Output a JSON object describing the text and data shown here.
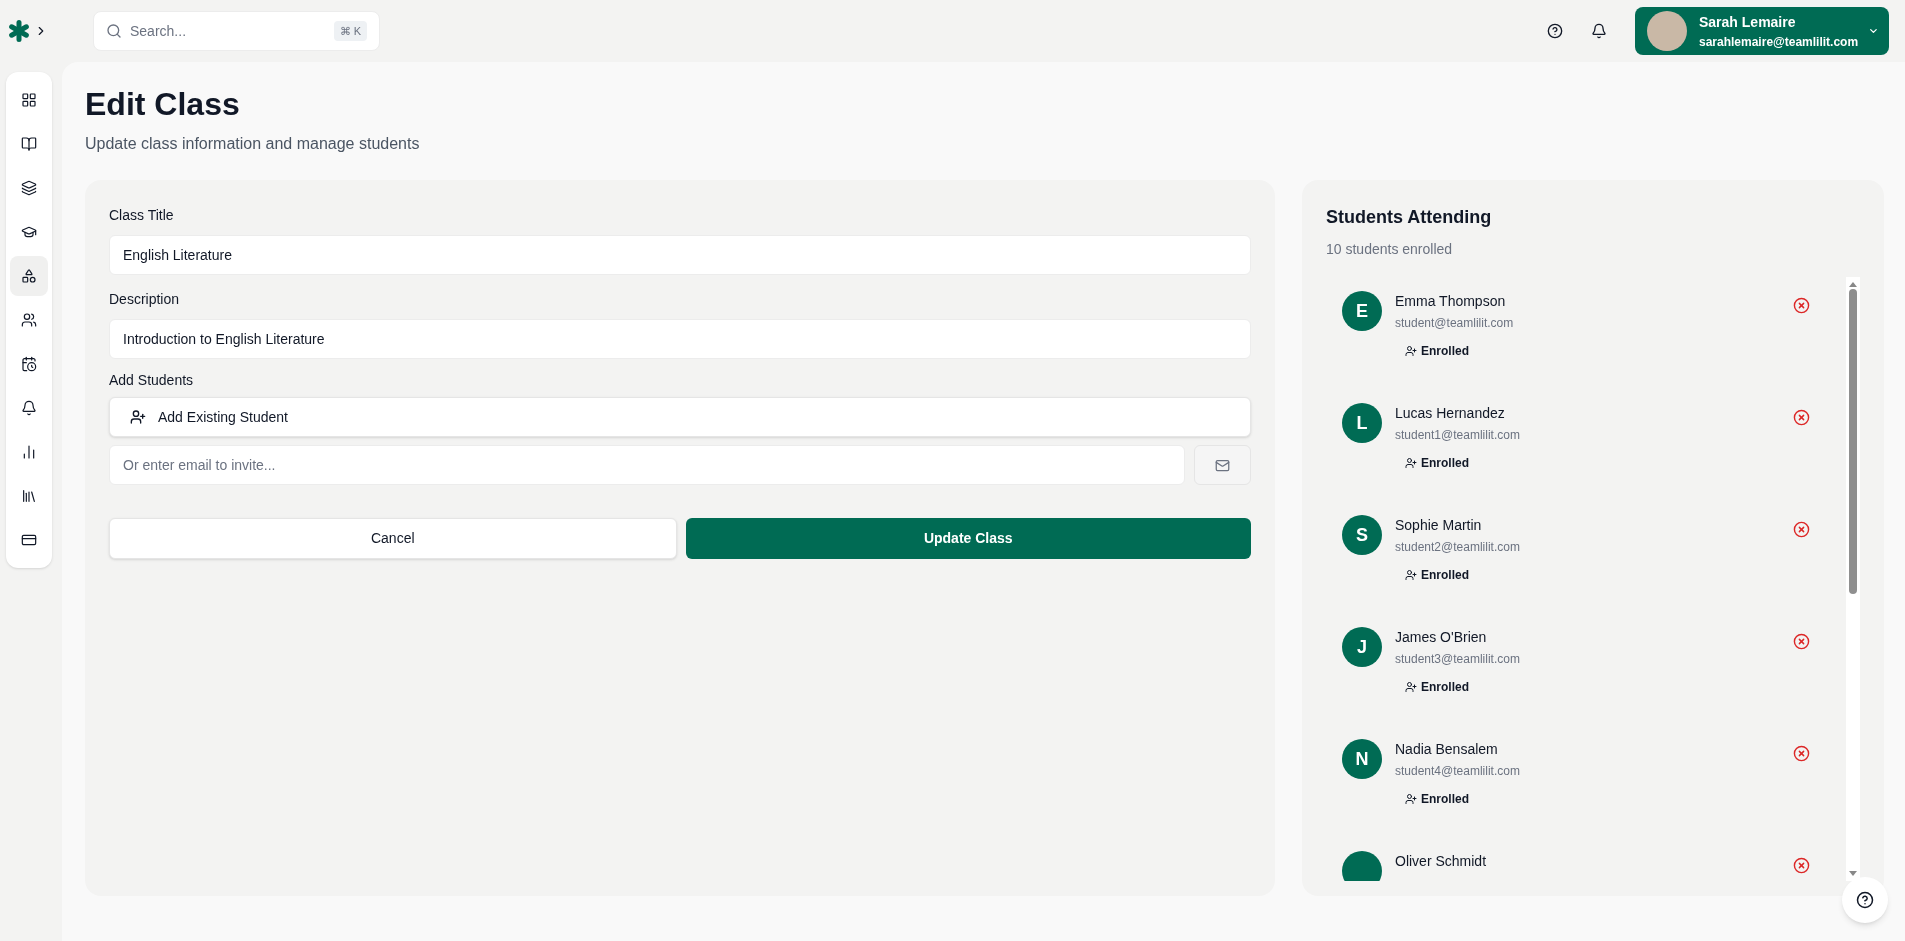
{
  "search": {
    "placeholder": "Search...",
    "shortcut": "⌘ K"
  },
  "user": {
    "name": "Sarah Lemaire",
    "email": "sarahlemaire@teamlilit.com"
  },
  "sidebar": {
    "items": [
      {
        "selected": false
      },
      {
        "selected": false
      },
      {
        "selected": false
      },
      {
        "selected": false
      },
      {
        "selected": true
      },
      {
        "selected": false
      },
      {
        "selected": false
      },
      {
        "selected": false
      },
      {
        "selected": false
      },
      {
        "selected": false
      },
      {
        "selected": false
      }
    ]
  },
  "page": {
    "title": "Edit Class",
    "subtitle": "Update class information and manage students"
  },
  "form": {
    "fields": [
      {
        "label": "Class Title",
        "value": "English Literature"
      },
      {
        "label": "Description",
        "value": "Introduction to English Literature"
      }
    ],
    "add_students": {
      "label": "Add Students",
      "button": "Add Existing Student",
      "invite_placeholder": "Or enter email to invite..."
    },
    "buttons": {
      "cancel": "Cancel",
      "submit": "Update Class"
    }
  },
  "students_panel": {
    "title": "Students Attending",
    "count": "10 students enrolled",
    "students": [
      {
        "initial": "E",
        "name": "Emma Thompson",
        "email": "student@teamlilit.com",
        "status": "Enrolled"
      },
      {
        "initial": "L",
        "name": "Lucas Hernandez",
        "email": "student1@teamlilit.com",
        "status": "Enrolled"
      },
      {
        "initial": "S",
        "name": "Sophie Martin",
        "email": "student2@teamlilit.com",
        "status": "Enrolled"
      },
      {
        "initial": "J",
        "name": "James O'Brien",
        "email": "student3@teamlilit.com",
        "status": "Enrolled"
      },
      {
        "initial": "N",
        "name": "Nadia Bensalem",
        "email": "student4@teamlilit.com",
        "status": "Enrolled"
      },
      {
        "name": "Oliver Schmidt"
      }
    ]
  }
}
